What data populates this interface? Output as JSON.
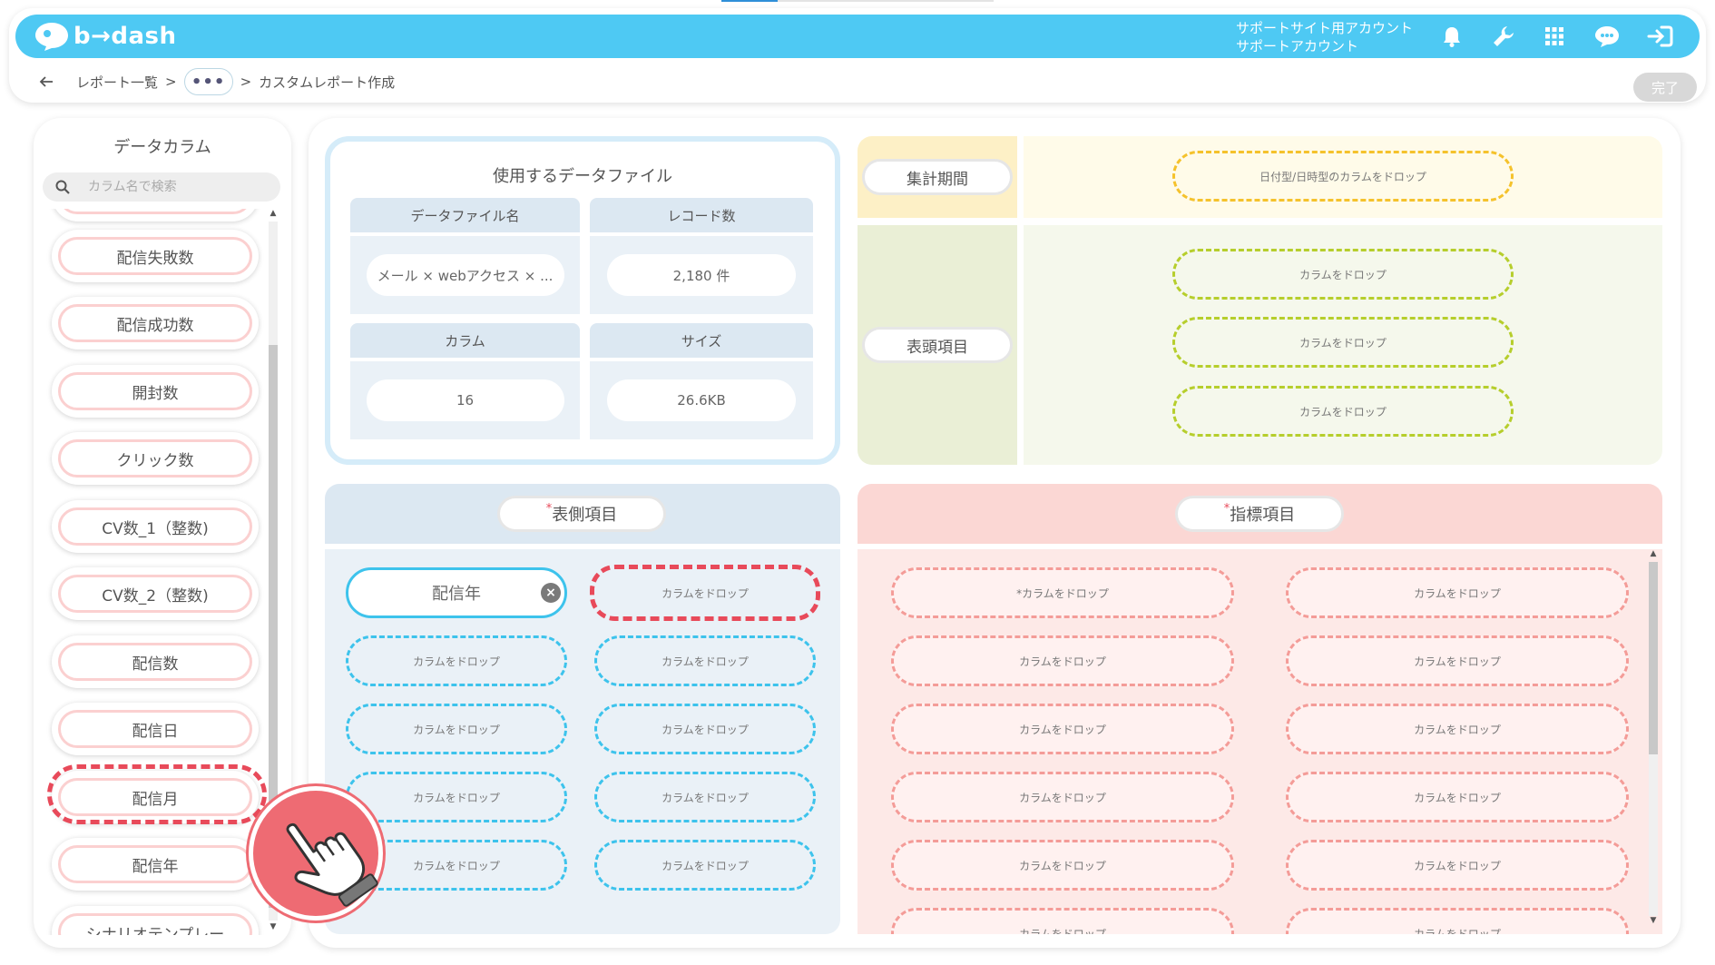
{
  "header": {
    "logo_text": "b→dash",
    "account_line1": "サポートサイト用アカウント",
    "account_line2": "サポートアカウント",
    "icons": [
      "bell-icon",
      "wrench-icon",
      "grid-icon",
      "chat-icon",
      "logout-icon"
    ]
  },
  "breadcrumb": {
    "back_icon": "arrow-left-icon",
    "items": [
      "レポート一覧",
      "•••",
      "カスタムレポート作成"
    ],
    "sep": ">"
  },
  "done_label": "完了",
  "left_panel": {
    "title": "データカラム",
    "search_placeholder": "カラム名で検索",
    "columns": [
      "配信失敗数",
      "配信成功数",
      "開封数",
      "クリック数",
      "CV数_1（整数)",
      "CV数_2（整数)",
      "配信数",
      "配信日",
      "配信月",
      "配信年",
      "シナリオテンプレー"
    ]
  },
  "file_info": {
    "title": "使用するデータファイル",
    "file_name_header": "データファイル名",
    "file_name_value": "メール × webアクセス × ...",
    "record_header": "レコード数",
    "record_value": "2,180 件",
    "column_header": "カラム",
    "column_value": "16",
    "size_header": "サイズ",
    "size_value": "26.6KB"
  },
  "period": {
    "label": "集計期間",
    "drop_text": "日付型/日時型のカラムをドロップ"
  },
  "header_items": {
    "label": "表頭項目",
    "drops": [
      "カラムをドロップ",
      "カラムをドロップ",
      "カラムをドロップ"
    ]
  },
  "row_items": {
    "required_mark": "*",
    "label": "表側項目",
    "filled_value": "配信年",
    "drop_text": "カラムをドロップ"
  },
  "metric_items": {
    "required_mark": "*",
    "label": "指標項目",
    "first_drop_text": "*カラムをドロップ",
    "drop_text": "カラムをドロップ"
  },
  "colors": {
    "brand": "#4ec9f3",
    "highlight": "#e84a5a",
    "hand_circle": "#ee6b73"
  }
}
